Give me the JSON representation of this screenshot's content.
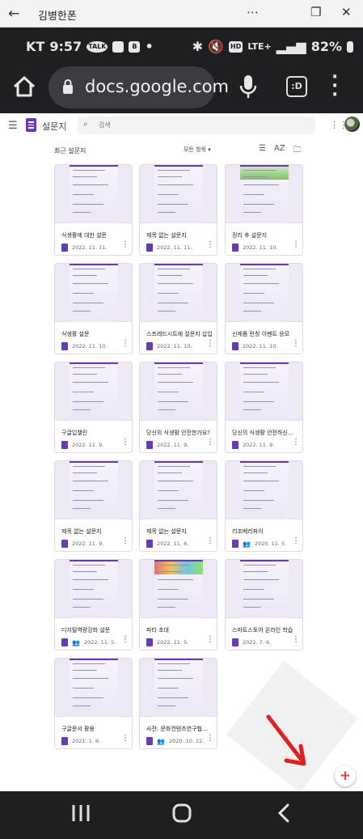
{
  "window": {
    "title": "김병한폰",
    "back": "←",
    "min": "⋯",
    "restore": "❐",
    "close": "✕"
  },
  "status": {
    "carrier": "KT",
    "time": "9:57",
    "talk": "TALK",
    "b_badge": "B",
    "dot": "•",
    "battery": "82%",
    "lte": "LTE+",
    "hd": "HD"
  },
  "browser": {
    "url": "docs.google.com",
    "tabs_label": ":D"
  },
  "forms": {
    "app_name": "설문지",
    "search_placeholder": "검색",
    "recent_label": "최근 설문지",
    "owner_filter": "모든 항목 ▾",
    "sort_icon": "AZ"
  },
  "cards": [
    {
      "title": "식생활에 대한 설문",
      "date": "2022. 11. 11.",
      "shared": false,
      "thumb": "plain"
    },
    {
      "title": "제목 없는 설문지",
      "date": "2022. 11. 11.",
      "shared": false,
      "thumb": "plain"
    },
    {
      "title": "정리 후 설문지",
      "date": "2022. 11. 10.",
      "shared": false,
      "thumb": "banner"
    },
    {
      "title": "식생활 설문",
      "date": "2022. 11. 10.",
      "shared": false,
      "thumb": "plain"
    },
    {
      "title": "스프레드시트에 설문지 삽입",
      "date": "2022. 11. 10.",
      "shared": false,
      "thumb": "plain"
    },
    {
      "title": "신제품 런칭 이벤트 응모",
      "date": "2022. 11. 10.",
      "shared": false,
      "thumb": "plain"
    },
    {
      "title": "구글입챌린",
      "date": "2022. 11. 9.",
      "shared": false,
      "thumb": "plain"
    },
    {
      "title": "당신의 식생활 안전한가요?",
      "date": "2022. 11. 9.",
      "shared": false,
      "thumb": "plain"
    },
    {
      "title": "당신의 식생활 안전하신가요?",
      "date": "2022. 11. 9.",
      "shared": false,
      "thumb": "plain"
    },
    {
      "title": "제목 없는 설문지",
      "date": "2022. 11. 9.",
      "shared": false,
      "thumb": "plain"
    },
    {
      "title": "제목 없는 설문지",
      "date": "2022. 11. 6.",
      "shared": false,
      "thumb": "plain"
    },
    {
      "title": "리조베리파이",
      "date": "2020. 11. 5.",
      "shared": true,
      "thumb": "plain"
    },
    {
      "title": "디지털역량강화 설문",
      "date": "2022. 11. 5.",
      "shared": true,
      "thumb": "plain"
    },
    {
      "title": "파티 초대",
      "date": "2022. 11. 5.",
      "shared": false,
      "thumb": "colorful"
    },
    {
      "title": "스마트스토어 온라인 학습",
      "date": "2022. 7. 6.",
      "shared": false,
      "thumb": "plain"
    },
    {
      "title": "구글문서 활용",
      "date": "2021. 1. 6.",
      "shared": false,
      "thumb": "plain"
    },
    {
      "title": "사전: 문화컨텐츠연구협회_회…",
      "date": "2020. 10. 22.",
      "shared": true,
      "thumb": "plain"
    }
  ],
  "colors": {
    "forms_purple": "#673ab7",
    "arrow_red": "#e02020",
    "phone_bg": "#1e1f23"
  }
}
